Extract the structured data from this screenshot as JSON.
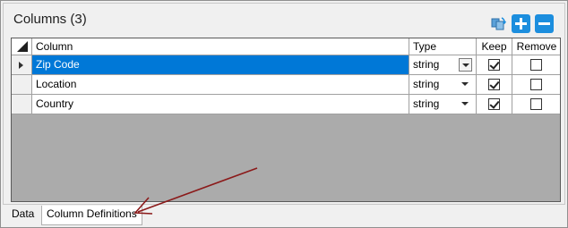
{
  "panel": {
    "title": "Columns (3)"
  },
  "toolbar": {
    "refresh_icon": "refresh-icon",
    "add_icon": "plus-icon",
    "remove_icon": "minus-icon",
    "accent_color": "#1c8ede"
  },
  "grid": {
    "headers": [
      "Column",
      "Type",
      "Keep",
      "Remove"
    ],
    "rows": [
      {
        "column": "Zip Code",
        "type": "string",
        "keep": true,
        "remove": false,
        "selected": true
      },
      {
        "column": "Location",
        "type": "string",
        "keep": true,
        "remove": false,
        "selected": false
      },
      {
        "column": "Country",
        "type": "string",
        "keep": true,
        "remove": false,
        "selected": false
      }
    ],
    "selection_color": "#0078d7"
  },
  "tabs": [
    {
      "label": "Data",
      "active": false
    },
    {
      "label": "Column Definitions",
      "active": true
    }
  ],
  "annotation": {
    "arrow_color": "#8b1a1a"
  }
}
